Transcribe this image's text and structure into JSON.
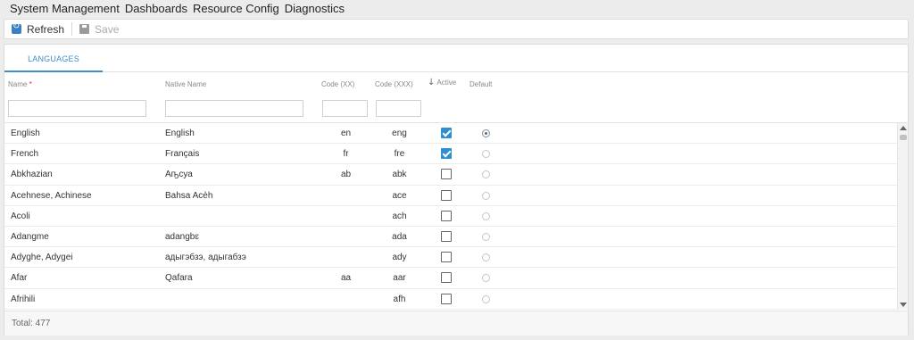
{
  "menu": [
    "System Management",
    "Dashboards",
    "Resource Config",
    "Diagnostics"
  ],
  "toolbar": {
    "refresh_label": "Refresh",
    "save_label": "Save"
  },
  "tabs": [
    {
      "label": "LANGUAGES",
      "active": true
    }
  ],
  "columns": {
    "name": "Name",
    "required_mark": "*",
    "native": "Native Name",
    "code2": "Code (XX)",
    "code3": "Code (XXX)",
    "active": "Active",
    "default": "Default"
  },
  "filters": {
    "name": "",
    "native": "",
    "code2": "",
    "code3": ""
  },
  "rows": [
    {
      "name": "English",
      "native": "English",
      "code2": "en",
      "code3": "eng",
      "active": true,
      "default": true
    },
    {
      "name": "French",
      "native": "Français",
      "code2": "fr",
      "code3": "fre",
      "active": true,
      "default": false
    },
    {
      "name": "Abkhazian",
      "native": "Аҧсуа",
      "code2": "ab",
      "code3": "abk",
      "active": false,
      "default": false
    },
    {
      "name": "Acehnese, Achinese",
      "native": "Bahsa Acèh",
      "code2": "",
      "code3": "ace",
      "active": false,
      "default": false
    },
    {
      "name": "Acoli",
      "native": "",
      "code2": "",
      "code3": "ach",
      "active": false,
      "default": false
    },
    {
      "name": "Adangme",
      "native": "adangbɛ",
      "code2": "",
      "code3": "ada",
      "active": false,
      "default": false
    },
    {
      "name": "Adyghe, Adygei",
      "native": "адыгэбзэ, адыгабзэ",
      "code2": "",
      "code3": "ady",
      "active": false,
      "default": false
    },
    {
      "name": "Afar",
      "native": "Qafara",
      "code2": "aa",
      "code3": "aar",
      "active": false,
      "default": false
    },
    {
      "name": "Afrihili",
      "native": "",
      "code2": "",
      "code3": "afh",
      "active": false,
      "default": false
    }
  ],
  "footer": {
    "total_text": "Total: 477"
  },
  "colors": {
    "accent": "#3d8ec8",
    "checkbox": "#2f8fd0",
    "required": "#d32f2f"
  }
}
